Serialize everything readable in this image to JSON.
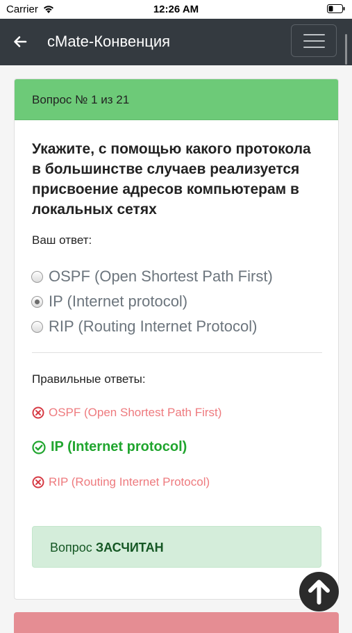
{
  "status_bar": {
    "carrier": "Carrier",
    "time": "12:26 AM"
  },
  "navbar": {
    "title": "cMate-Конвенция"
  },
  "card": {
    "header": "Вопрос № 1 из 21",
    "question": "Укажите, с помощью какого протокола в большинстве случаев реализуется присвоение адресов компьютерам в локальных сетях",
    "your_answer_label": "Ваш ответ:",
    "options": [
      {
        "label": "OSPF (Open Shortest Path First)",
        "selected": false
      },
      {
        "label": "IP (Internet protocol)",
        "selected": true
      },
      {
        "label": "RIP (Routing Internet Protocol)",
        "selected": false
      }
    ],
    "correct_answers_label": "Правильные ответы:",
    "answers": [
      {
        "label": "OSPF (Open Shortest Path First)",
        "status": "wrong"
      },
      {
        "label": "IP (Internet protocol)",
        "status": "correct"
      },
      {
        "label": "RIP (Routing Internet Protocol)",
        "status": "wrong"
      }
    ],
    "result": {
      "prefix": "Вопрос",
      "status": "ЗАСЧИТАН"
    }
  },
  "colors": {
    "header_green": "#6dca78",
    "navbar": "#343a40",
    "wrong": "#ee7a7e",
    "correct": "#20a52e",
    "alert_bg": "#d4edda"
  }
}
